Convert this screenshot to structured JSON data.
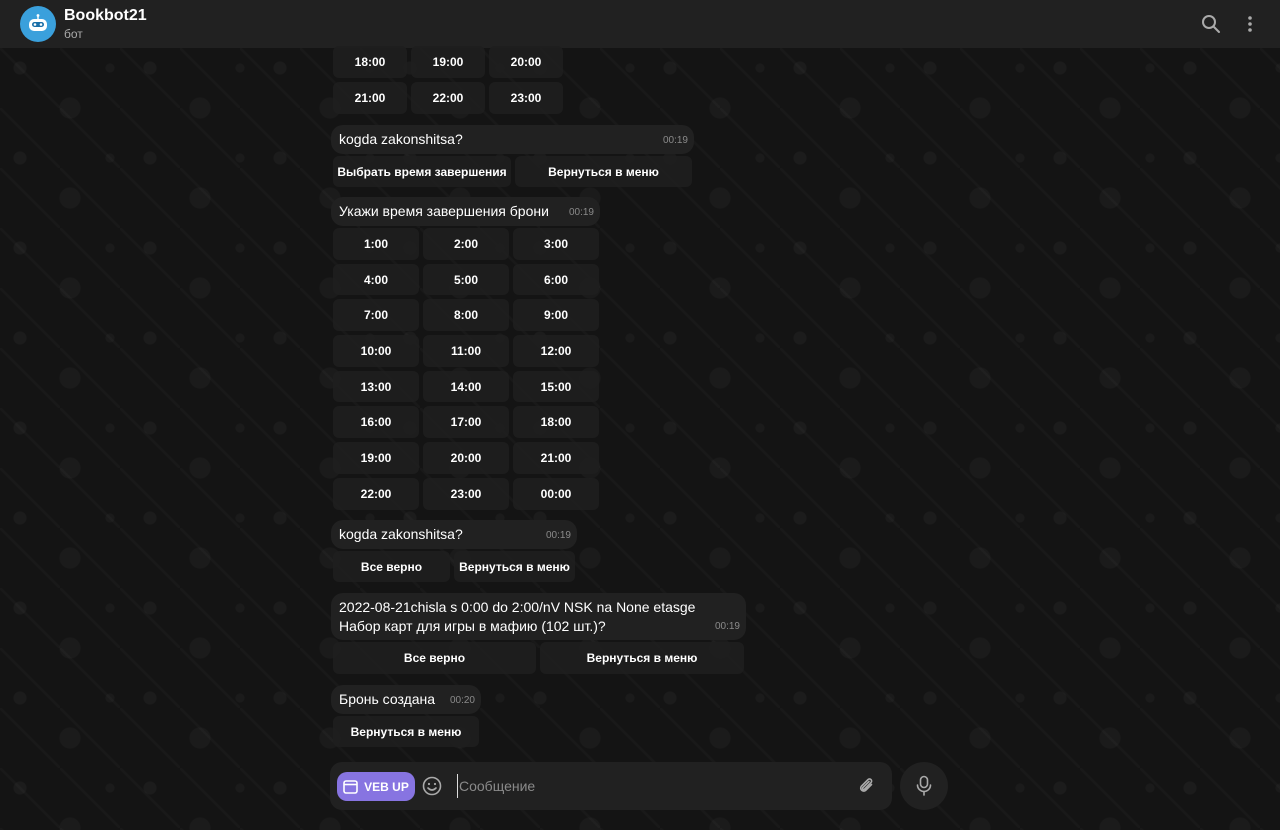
{
  "header": {
    "title": "Bookbot21",
    "subtitle": "бот"
  },
  "top_keyboard": {
    "rows": [
      [
        "18:00",
        "19:00",
        "20:00"
      ],
      [
        "21:00",
        "22:00",
        "23:00"
      ]
    ]
  },
  "messages": [
    {
      "text": "kogda zakonshitsa?",
      "time": "00:19",
      "buttons": [
        "Выбрать время завершения",
        "Вернуться в меню"
      ]
    },
    {
      "text": "Укажи время завершения брони",
      "time": "00:19",
      "buttons": [
        [
          "1:00",
          "2:00",
          "3:00"
        ],
        [
          "4:00",
          "5:00",
          "6:00"
        ],
        [
          "7:00",
          "8:00",
          "9:00"
        ],
        [
          "10:00",
          "11:00",
          "12:00"
        ],
        [
          "13:00",
          "14:00",
          "15:00"
        ],
        [
          "16:00",
          "17:00",
          "18:00"
        ],
        [
          "19:00",
          "20:00",
          "21:00"
        ],
        [
          "22:00",
          "23:00",
          "00:00"
        ]
      ]
    },
    {
      "text": "kogda zakonshitsa?",
      "time": "00:19",
      "buttons": [
        "Все верно",
        "Вернуться в меню"
      ]
    },
    {
      "text_line1": "2022-08-21chisla  s 0:00 do 2:00/nV NSK na None etasge",
      "text_line2": "Набор карт для игры в мафию (102 шт.)?",
      "time": "00:19",
      "buttons": [
        "Все верно",
        "Вернуться в меню"
      ]
    },
    {
      "text": "Бронь создана",
      "time": "00:20",
      "buttons": [
        "Вернуться в меню"
      ]
    }
  ],
  "composer": {
    "veb_label": "VEB UP",
    "placeholder": "Сообщение"
  },
  "icons": {
    "search": "search-icon",
    "menu": "more-vertical-icon",
    "emoji": "emoji-icon",
    "attach": "paperclip-icon",
    "mic": "microphone-icon",
    "app": "app-window-icon"
  },
  "colors": {
    "accent": "#8774e1",
    "avatar": "#3aa0dc",
    "bubble": "#212121",
    "header": "#212121"
  }
}
